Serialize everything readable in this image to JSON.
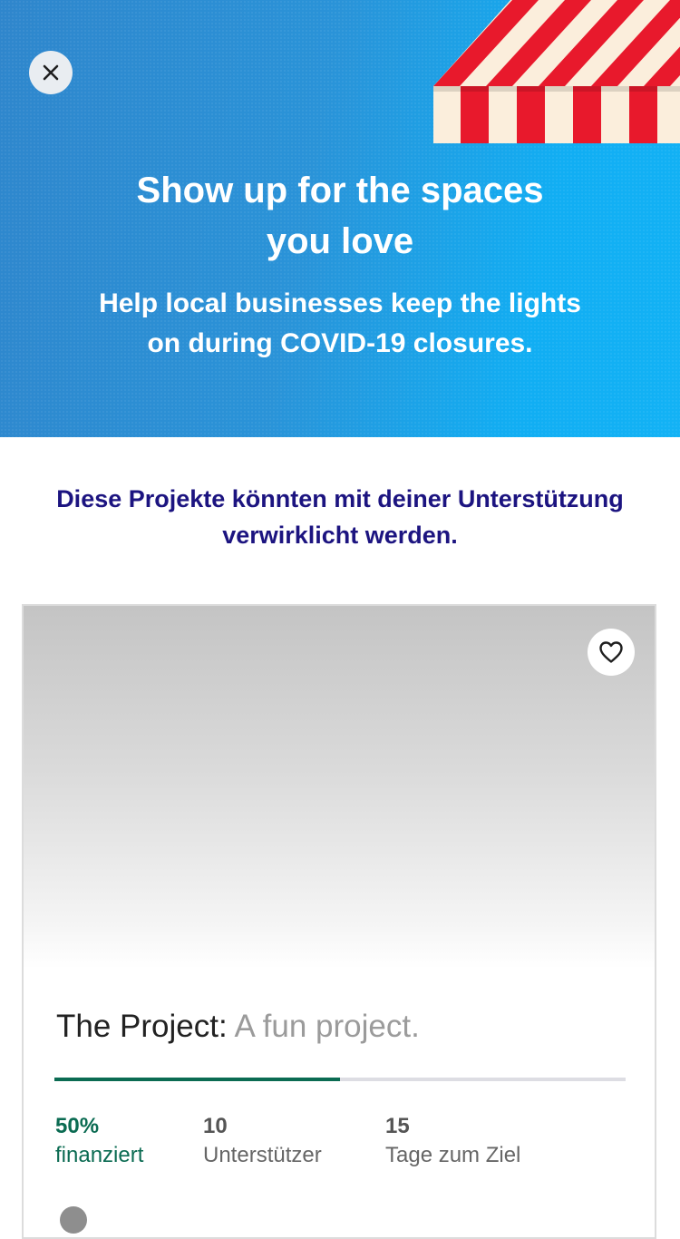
{
  "hero": {
    "title_line1": "Show up for the spaces",
    "title_line2": "you love",
    "subtitle_line1": "Help local businesses keep the lights",
    "subtitle_line2": "on during COVID-19 closures.",
    "close_icon": "close-icon",
    "awning_colors": [
      "#e8192c",
      "#fbeedc"
    ]
  },
  "section": {
    "heading_line1": "Diese Projekte könnten mit deiner Unterstützung",
    "heading_line2": "verwirklicht werden."
  },
  "project": {
    "name": "The Project:",
    "blurb": "A fun project.",
    "favorite_icon": "heart-icon",
    "funded_fraction": 0.5,
    "stats": {
      "funded_value": "50%",
      "funded_label": "finanziert",
      "backers_value": "10",
      "backers_label": "Unterstützer",
      "days_value": "15",
      "days_label": "Tage zum Ziel"
    }
  },
  "colors": {
    "accent_green": "#0b6b52",
    "heading_navy": "#1c1480",
    "hero_blue": "#2a93d8"
  }
}
